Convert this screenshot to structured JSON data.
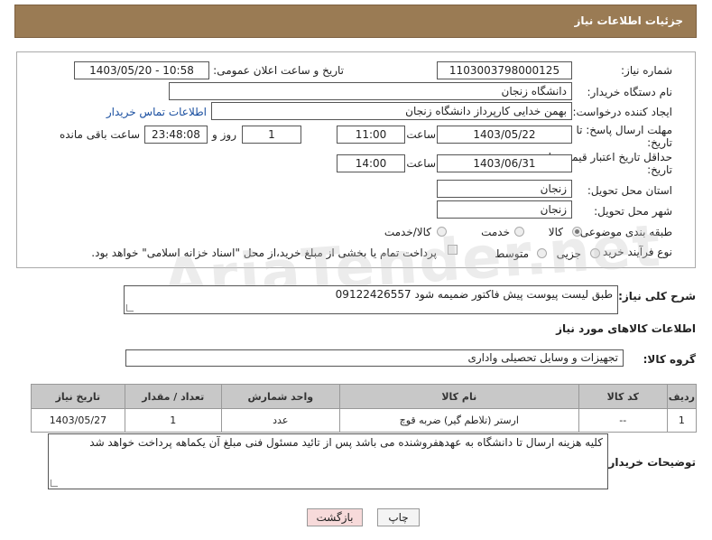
{
  "header": {
    "title": "جزئیات اطلاعات نیاز"
  },
  "form": {
    "need_number_label": "شماره نیاز:",
    "need_number": "1103003798000125",
    "announce_label": "تاریخ و ساعت اعلان عمومی:",
    "announce_value": "1403/05/20 - 10:58",
    "buyer_org_label": "نام دستگاه خریدار:",
    "buyer_org": "دانشگاه زنجان",
    "requester_label": "ایجاد کننده درخواست:",
    "requester": "بهمن خدایی کارپرداز دانشگاه زنجان",
    "contact_link": "اطلاعات تماس خریدار",
    "deadline_label_1": "مهلت ارسال پاسخ: تا",
    "deadline_label_2": "تاریخ:",
    "deadline_date": "1403/05/22",
    "time_label": "ساعت",
    "deadline_time": "11:00",
    "days_value": "1",
    "days_label": "روز و",
    "remaining_time": "23:48:08",
    "remaining_label": "ساعت باقی مانده",
    "price_valid_label_1": "حداقل تاریخ اعتبار قیمت: تا",
    "price_valid_label_2": "تاریخ:",
    "price_valid_date": "1403/06/31",
    "price_valid_time": "14:00",
    "province_label": "استان محل تحویل:",
    "province": "زنجان",
    "city_label": "شهر محل تحویل:",
    "city": "زنجان",
    "category_label": "طبقه بندی موضوعی:",
    "category_options": [
      "کالا",
      "خدمت",
      "کالا/خدمت"
    ],
    "category_selected": "کالا",
    "purchase_type_label": "نوع فرآیند خرید :",
    "purchase_options": [
      "جزیی",
      "متوسط"
    ],
    "purchase_selected": "جزیی",
    "payment_note": "پرداخت تمام یا بخشی از مبلغ خرید،از محل \"اسناد خزانه اسلامی\" خواهد بود."
  },
  "description": {
    "label": "شرح کلی نیاز:",
    "value": "طبق لیست پیوست پیش فاکتور ضمیمه شود 09122426557"
  },
  "goods_section": {
    "title": "اطلاعات کالاهای مورد نیاز",
    "group_label": "گروه کالا:",
    "group_value": "تجهیزات و وسایل تحصیلی واداری"
  },
  "table": {
    "headers": [
      "ردیف",
      "کد کالا",
      "نام کالا",
      "واحد شمارش",
      "تعداد / مقدار",
      "تاریخ نیاز"
    ],
    "rows": [
      [
        "1",
        "--",
        "ارستر (تلاطم گیر) ضربه قوچ",
        "عدد",
        "1",
        "1403/05/27"
      ]
    ]
  },
  "buyer_notes": {
    "label": "توضیحات خریدار:",
    "value": "کلیه هزینه ارسال تا دانشگاه به عهدهفروشنده می باشد پس از تائید مسئول فنی مبلغ آن یکماهه پرداخت خواهد شد"
  },
  "buttons": {
    "print": "چاپ",
    "back": "بازگشت"
  },
  "watermark": "AriaTender.net",
  "colors": {
    "header_bg": "#9a7b54",
    "table_header_bg": "#c8c8c8",
    "link": "#1a4fa0",
    "back_button_bg": "#f7dada"
  }
}
